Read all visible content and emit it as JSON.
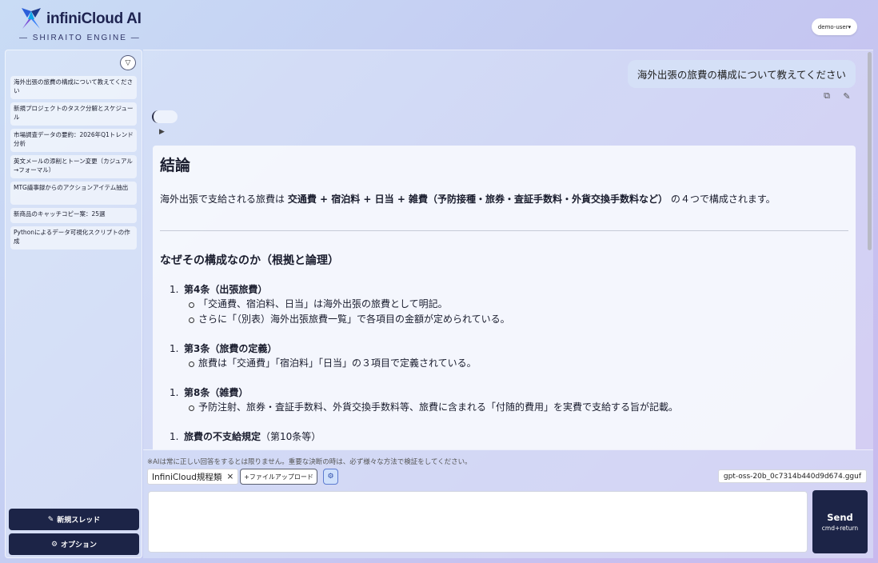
{
  "header": {
    "brand": "infiniCloud AI",
    "engine": "— SHIRAITO ENGINE —",
    "user_label": "demo-user▾"
  },
  "sidebar": {
    "collapse_glyph": "▽",
    "threads": [
      "海外出張の旅費の構成について教えてください",
      "新規プロジェクトのタスク分解とスケジュール",
      "市場調査データの要約：2026年Q1トレンド分析",
      "英文メールの添削とトーン変更（カジュアル→フォーマル）",
      "MTG議事録からのアクションアイテム抽出",
      "新商品のキャッチコピー案：25選",
      "Pythonによるデータ可視化スクリプトの作成"
    ],
    "new_thread_label": "新規スレッド",
    "options_label": "オプション",
    "new_thread_icon": "edit-icon",
    "options_icon": "gear-icon"
  },
  "chat": {
    "user_message": "海外出張の旅費の構成について教えてください",
    "answer": {
      "heading_conclusion": "結論",
      "conclusion_prefix": "海外出張で支給される旅費は ",
      "conclusion_bold": "交通費 + 宿泊料 + 日当 + 雑費（予防接種・旅券・査証手数料・外貨交換手数料など）",
      "conclusion_suffix": " の４つで構成されます。",
      "heading_reason": "なぜその構成なのか（根拠と論理）",
      "items": [
        {
          "number": "1.",
          "title": "第4条（出張旅費）",
          "title_suffix": "",
          "bullets": [
            "「交通費、宿泊料、日当」は海外出張の旅費として明記。",
            "さらに「（別表）海外出張旅費一覧」で各項目の金額が定められている。"
          ]
        },
        {
          "number": "1.",
          "title": "第3条（旅費の定義）",
          "title_suffix": "",
          "bullets": [
            "旅費は「交通費」「宿泊料」「日当」の３項目で定義されている。"
          ]
        },
        {
          "number": "1.",
          "title": "第8条（雑費）",
          "title_suffix": "",
          "bullets": [
            "予防注射、旅券・査証手数料、外貨交換手数料等、旅費に含まれる「付随的費用」を実費で支給する旨が記載。"
          ]
        },
        {
          "number": "1.",
          "title": "旅費の不支給規定",
          "title_suffix": "（第10条等）",
          "bullets": []
        }
      ]
    }
  },
  "composer": {
    "disclaimer": "※AIは常に正しい回答をするとは限りません。重要な決断の時は、必ず様々な方法で検証をしてください。",
    "kb_chip": "InfiniCloud規程類",
    "kb_chip_close": "×",
    "upload_label": "+ファイルアップロード",
    "model": "gpt-oss-20b_0c7314b440d9d674.gguf",
    "input_placeholder": "",
    "send_label": "Send",
    "send_shortcut": "cmd+return"
  }
}
